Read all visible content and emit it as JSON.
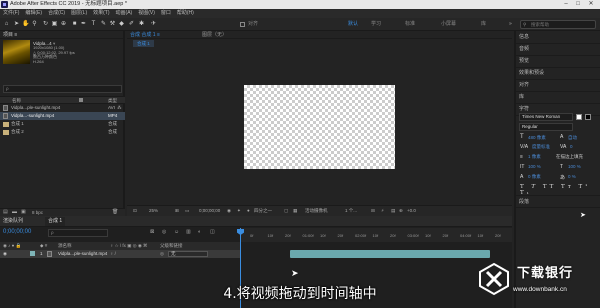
{
  "window": {
    "title": "Adobe After Effects CC 2019 - 无标题项目.aep *"
  },
  "menu": [
    "文件(F)",
    "编辑(E)",
    "合成(C)",
    "图层(L)",
    "效果(T)",
    "动画(A)",
    "视图(V)",
    "窗口",
    "帮助(H)"
  ],
  "toolbar": {
    "align_label": "对齐",
    "workspaces": [
      "默认",
      "学习",
      "标准",
      "小屏幕",
      "库"
    ],
    "search_placeholder": "搜索帮助"
  },
  "project": {
    "title": "项目 ≡",
    "file_name": "Vidpla...4",
    "meta": [
      "1920x1080 (1.00)",
      "△ 0;00;12;02, 29.97 fps",
      "数百万种颜色",
      "H.264"
    ],
    "search_placeholder": "ρ",
    "columns": {
      "name": "名称",
      "tag": "",
      "type": "类型"
    },
    "items": [
      {
        "name": "Vidpla...ple-sunlight.mp4",
        "type": "AVI",
        "kind": "file",
        "selected": false
      },
      {
        "name": "Vidpla...-sunlight.mp4",
        "type": "MP4",
        "kind": "file",
        "selected": true
      },
      {
        "name": "合成 1",
        "type": "合成",
        "kind": "comp",
        "selected": false
      },
      {
        "name": "合成 2",
        "type": "合成",
        "kind": "comp",
        "selected": false
      }
    ],
    "bpc": "8 bpc"
  },
  "composition": {
    "tab_label": "合成 合成 1 ≡",
    "layer_tab": "图层（无）",
    "breadcrumb": "合成 1"
  },
  "viewer": {
    "zoom": "25%",
    "timecode": "0;00;00;00",
    "resolution": "四分之一",
    "camera": "活动摄像机",
    "views": "1 个...",
    "offset": "+0.0"
  },
  "right_panel": {
    "tabs": [
      "信息",
      "音频",
      "预览",
      "效果和预设",
      "对齐",
      "库",
      "字符"
    ],
    "character": {
      "font": "Times New Roman",
      "style": "Regular",
      "size": "480 像素",
      "leading": "自动",
      "kerning": "度量标准",
      "tracking": "0",
      "stroke": "1 像素",
      "stroke_mode": "在描边上填充",
      "vscale": "100 %",
      "hscale": "100 %",
      "baseline": "0 像素",
      "tsume": "0 %"
    },
    "paragraph_label": "段落"
  },
  "timeline": {
    "tabs": [
      "渲染队列",
      "合成 1"
    ],
    "timecode": "0;00;00;00",
    "search_placeholder": "ρ",
    "layer_cols": {
      "source": "源名称",
      "parent": "父级和链接"
    },
    "layer": {
      "index": "1",
      "name": "Vidpla...ple-sunlight.mp4",
      "parent": "无"
    },
    "ruler": [
      "0f",
      "10f",
      "20f",
      "01:00f",
      "10f",
      "20f",
      "02:00f",
      "10f",
      "20f",
      "03:00f",
      "10f",
      "20f",
      "04:00f",
      "10f",
      "20f"
    ]
  },
  "caption": "4.将视频拖动到时间轴中",
  "watermark": {
    "name": "下载银行",
    "url": "www.downbank.cn"
  }
}
